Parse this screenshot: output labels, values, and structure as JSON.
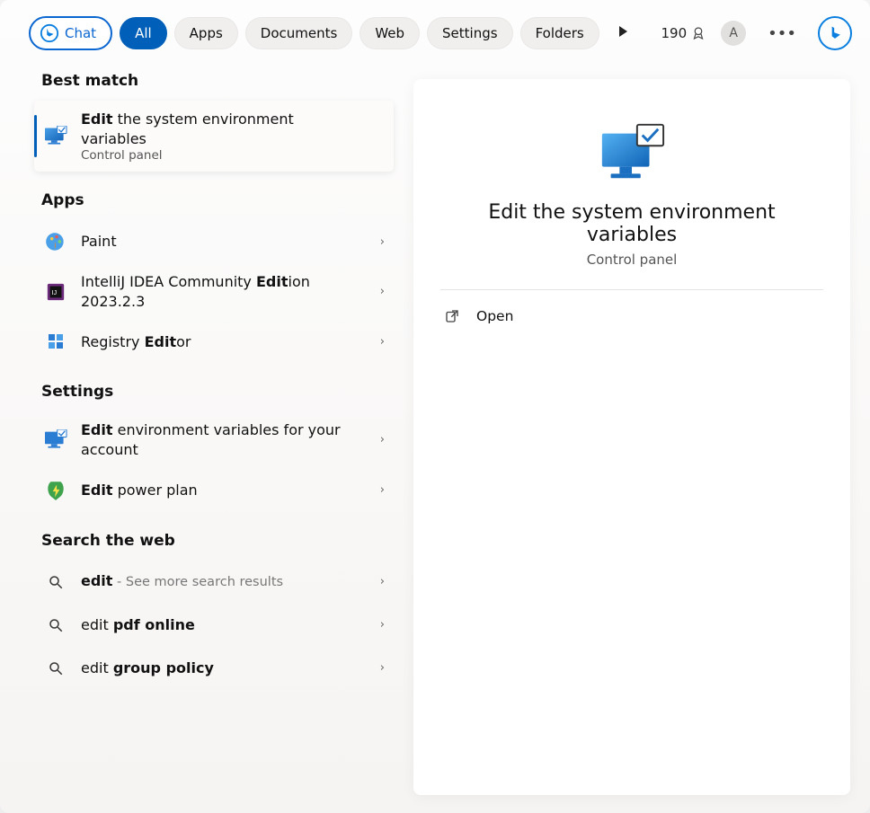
{
  "topbar": {
    "chat_label": "Chat",
    "tabs": [
      "All",
      "Apps",
      "Documents",
      "Web",
      "Settings",
      "Folders"
    ],
    "active_tab_index": 0,
    "rewards_points": "190",
    "avatar_initial": "A"
  },
  "sections": {
    "best_match": {
      "heading": "Best match",
      "item": {
        "title_bold": "Edit",
        "title_rest": " the system environment variables",
        "subtitle": "Control panel"
      }
    },
    "apps": {
      "heading": "Apps",
      "items": [
        {
          "title_plain": "Paint"
        },
        {
          "title_pre": "IntelliJ IDEA Community ",
          "title_bold": "Edit",
          "title_post": "ion 2023.2.3"
        },
        {
          "title_pre": "Registry ",
          "title_bold": "Edit",
          "title_post": "or"
        }
      ]
    },
    "settings": {
      "heading": "Settings",
      "items": [
        {
          "title_bold": "Edit",
          "title_rest": " environment variables for your account"
        },
        {
          "title_bold": "Edit",
          "title_rest": " power plan"
        }
      ]
    },
    "web": {
      "heading": "Search the web",
      "items": [
        {
          "title_bold": "edit",
          "hint": " - See more search results"
        },
        {
          "title_pre": "edit ",
          "title_bold": "pdf online"
        },
        {
          "title_pre": "edit ",
          "title_bold": "group policy"
        }
      ]
    }
  },
  "detail": {
    "title": "Edit the system environment variables",
    "subtitle": "Control panel",
    "open_label": "Open"
  }
}
